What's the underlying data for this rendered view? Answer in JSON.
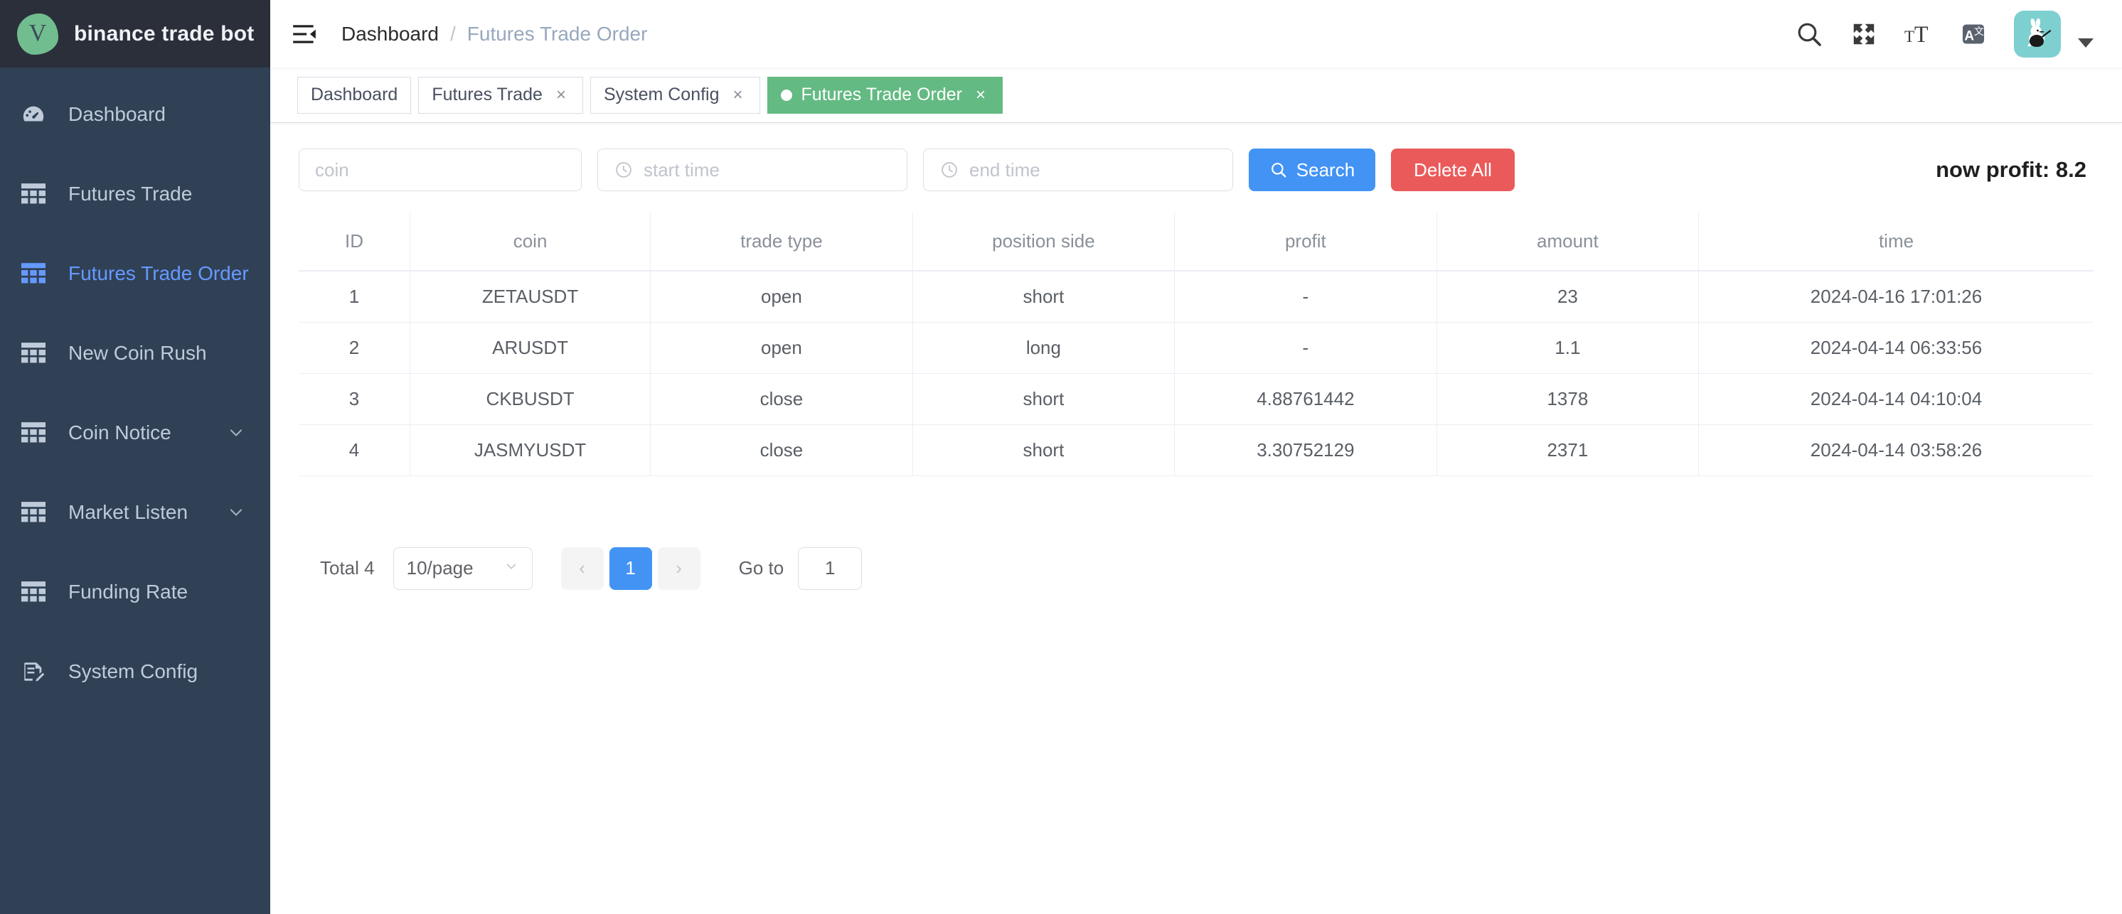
{
  "brand": {
    "logo_letter": "V",
    "title": "binance trade bot"
  },
  "sidebar": {
    "items": [
      {
        "label": "Dashboard",
        "icon": "dashboard-icon",
        "active": false,
        "expandable": false
      },
      {
        "label": "Futures Trade",
        "icon": "table-icon",
        "active": false,
        "expandable": false
      },
      {
        "label": "Futures Trade Order",
        "icon": "table-icon",
        "active": true,
        "expandable": false
      },
      {
        "label": "New Coin Rush",
        "icon": "table-icon",
        "active": false,
        "expandable": false
      },
      {
        "label": "Coin Notice",
        "icon": "table-icon",
        "active": false,
        "expandable": true
      },
      {
        "label": "Market Listen",
        "icon": "table-icon",
        "active": false,
        "expandable": true
      },
      {
        "label": "Funding Rate",
        "icon": "table-icon",
        "active": false,
        "expandable": false
      },
      {
        "label": "System Config",
        "icon": "document-edit-icon",
        "active": false,
        "expandable": false
      }
    ]
  },
  "navbar": {
    "hamburger_icon": "collapse-menu-icon",
    "breadcrumb": {
      "root": "Dashboard",
      "separator": "/",
      "current": "Futures Trade Order"
    },
    "icons": [
      "search-icon",
      "fullscreen-icon",
      "font-size-icon",
      "translate-icon"
    ],
    "avatar_icon": "user-avatar",
    "caret_icon": "caret-down-icon"
  },
  "tags": [
    {
      "label": "Dashboard",
      "closable": false,
      "active": false,
      "close": ""
    },
    {
      "label": "Futures Trade",
      "closable": true,
      "active": false,
      "close": "×"
    },
    {
      "label": "System Config",
      "closable": true,
      "active": false,
      "close": "×"
    },
    {
      "label": "Futures Trade Order",
      "closable": true,
      "active": true,
      "close": "×"
    }
  ],
  "filters": {
    "coin_placeholder": "coin",
    "start_time_placeholder": "start time",
    "end_time_placeholder": "end time",
    "coin_value": "",
    "start_time_value": "",
    "end_time_value": "",
    "search_label": "Search",
    "delete_all_label": "Delete All",
    "profit_text": "now profit: 8.2"
  },
  "colors": {
    "sidebar_bg": "#304156",
    "sidebar_logo_bg": "#2b2f3a",
    "logo_green": "#71bd8f",
    "active_blue": "#6699ff",
    "tag_active_green": "#63ba82",
    "button_blue": "#4293f4",
    "button_red": "#eb5a5a",
    "avatar_teal": "#7ed0d0"
  },
  "table": {
    "columns": [
      "ID",
      "coin",
      "trade type",
      "position side",
      "profit",
      "amount",
      "time"
    ],
    "rows": [
      {
        "id": "1",
        "coin": "ZETAUSDT",
        "trade_type": "open",
        "position_side": "short",
        "profit": "-",
        "amount": "23",
        "time": "2024-04-16 17:01:26"
      },
      {
        "id": "2",
        "coin": "ARUSDT",
        "trade_type": "open",
        "position_side": "long",
        "profit": "-",
        "amount": "1.1",
        "time": "2024-04-14 06:33:56"
      },
      {
        "id": "3",
        "coin": "CKBUSDT",
        "trade_type": "close",
        "position_side": "short",
        "profit": "4.88761442",
        "amount": "1378",
        "time": "2024-04-14 04:10:04"
      },
      {
        "id": "4",
        "coin": "JASMYUSDT",
        "trade_type": "close",
        "position_side": "short",
        "profit": "3.30752129",
        "amount": "2371",
        "time": "2024-04-14 03:58:26"
      }
    ]
  },
  "pagination": {
    "total_label": "Total 4",
    "page_size": "10/page",
    "prev_icon": "‹",
    "next_icon": "›",
    "pages": [
      "1"
    ],
    "current_page": "1",
    "goto_label": "Go to",
    "goto_value": "1"
  }
}
